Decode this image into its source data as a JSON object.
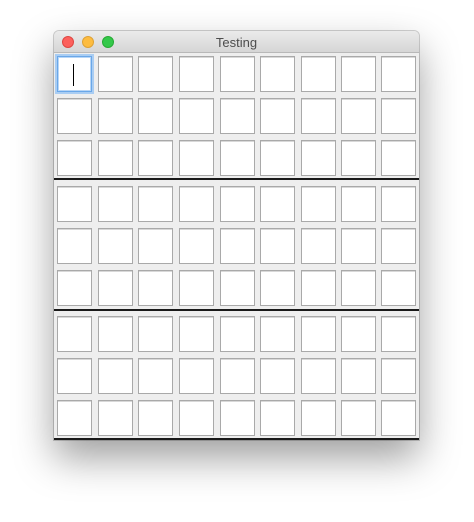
{
  "window": {
    "title": "Testing"
  },
  "grid": {
    "rows": 9,
    "cols": 9,
    "focused_cell": [
      0,
      0
    ],
    "cells": [
      [
        "",
        "",
        "",
        "",
        "",
        "",
        "",
        "",
        ""
      ],
      [
        "",
        "",
        "",
        "",
        "",
        "",
        "",
        "",
        ""
      ],
      [
        "",
        "",
        "",
        "",
        "",
        "",
        "",
        "",
        ""
      ],
      [
        "",
        "",
        "",
        "",
        "",
        "",
        "",
        "",
        ""
      ],
      [
        "",
        "",
        "",
        "",
        "",
        "",
        "",
        "",
        ""
      ],
      [
        "",
        "",
        "",
        "",
        "",
        "",
        "",
        "",
        ""
      ],
      [
        "",
        "",
        "",
        "",
        "",
        "",
        "",
        "",
        ""
      ],
      [
        "",
        "",
        "",
        "",
        "",
        "",
        "",
        "",
        ""
      ],
      [
        "",
        "",
        "",
        "",
        "",
        "",
        "",
        "",
        ""
      ]
    ]
  },
  "colors": {
    "close": "#fc605c",
    "minimize": "#fdbc40",
    "zoom": "#34c84a",
    "focus_ring": "#6aa7e8",
    "separator": "#1a1a1a"
  }
}
